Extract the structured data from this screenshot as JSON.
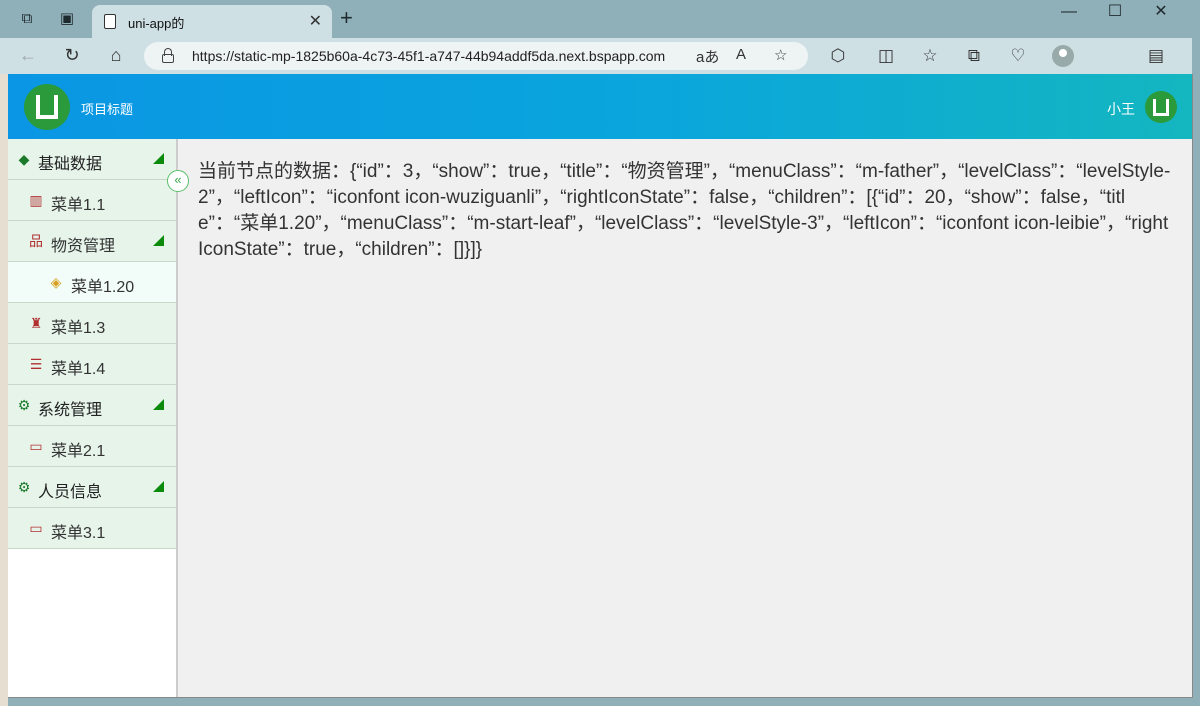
{
  "browser": {
    "tab_title": "uni-app的",
    "url": "https://static-mp-1825b60a-4c73-45f1-a747-44b94addf5da.next.bspapp.com",
    "window_controls": [
      "minimize-icon",
      "maximize-icon",
      "close-icon"
    ]
  },
  "header": {
    "title": "项目标题",
    "user_name": "小王"
  },
  "sidebar": {
    "items": [
      {
        "label": "基础数据",
        "level": 1,
        "icon": "layers-icon",
        "expanded": true
      },
      {
        "label": "菜单1.1",
        "level": 2,
        "icon": "book-icon"
      },
      {
        "label": "物资管理",
        "level": 2,
        "icon": "tree-icon",
        "expanded": true
      },
      {
        "label": "菜单1.20",
        "level": 3,
        "icon": "stack-icon",
        "active": true
      },
      {
        "label": "菜单1.3",
        "level": 2,
        "icon": "spy-icon"
      },
      {
        "label": "菜单1.4",
        "level": 2,
        "icon": "list-icon"
      },
      {
        "label": "系统管理",
        "level": 1,
        "icon": "gear-icon",
        "expanded": true
      },
      {
        "label": "菜单2.1",
        "level": 2,
        "icon": "monitor-icon"
      },
      {
        "label": "人员信息",
        "level": 1,
        "icon": "gear-icon",
        "expanded": true
      },
      {
        "label": "菜单3.1",
        "level": 2,
        "icon": "monitor-icon"
      }
    ]
  },
  "main": {
    "node_data_text": "当前节点的数据：{“id”：3，“show”：true，“title”：“物资管理”，“menuClass”：“m-father”，“levelClass”：“levelStyle-2”，“leftIcon”：“iconfont icon-wuziguanli”，“rightIconState”：false，“children”：[{“id”：20，“show”：false，“title”：“菜单1.20”，“menuClass”：“m-start-leaf”，“levelClass”：“levelStyle-3”，“leftIcon”：“iconfont icon-leibie”，“rightIconState”：true，“children”：[]}]}"
  },
  "colors": {
    "header_start": "#0a96e4",
    "header_end": "#14b6c0",
    "menu_bg": "#e6f4ea",
    "active_bg": "#f2fdfa",
    "arrow_green": "#0b8a0b",
    "logo_green": "#2a9a3a"
  }
}
